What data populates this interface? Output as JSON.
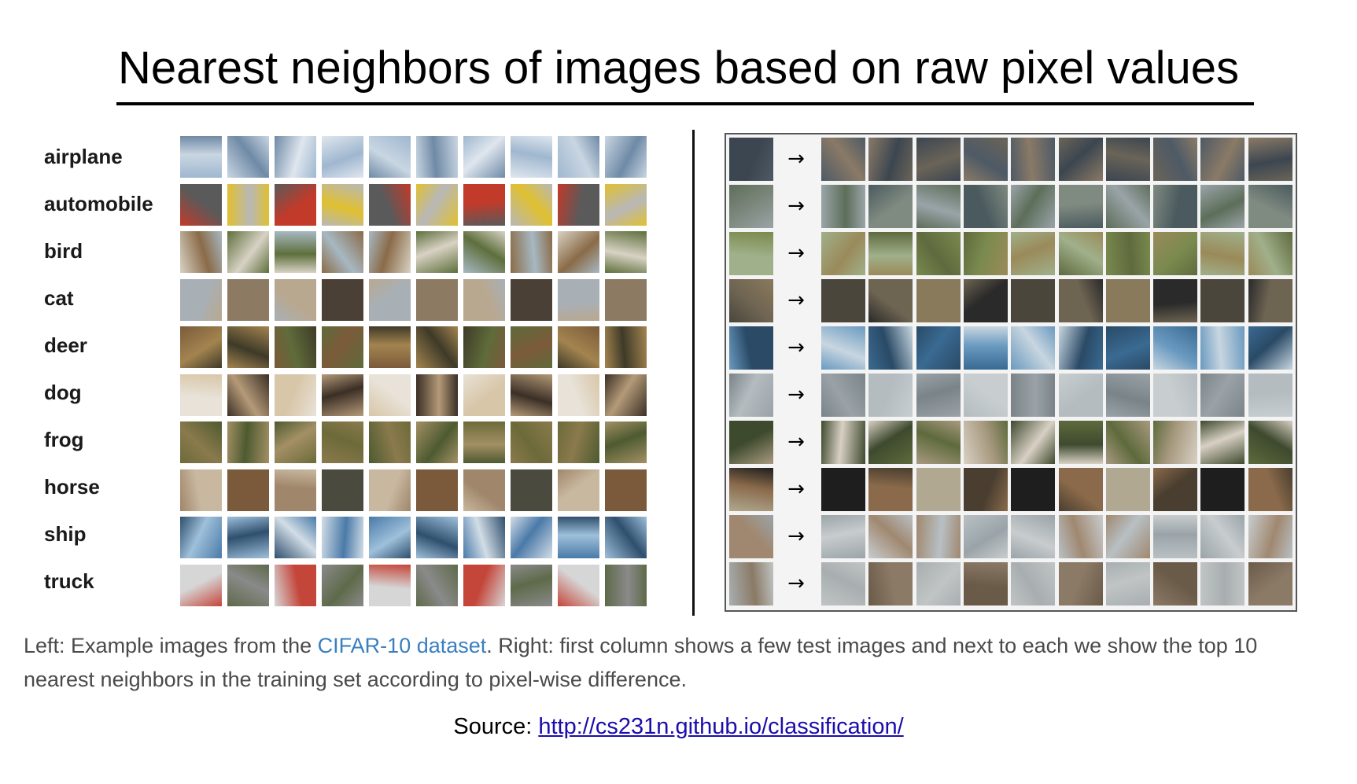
{
  "title": "Nearest neighbors of images based on raw pixel values",
  "classes": [
    "airplane",
    "automobile",
    "bird",
    "cat",
    "deer",
    "dog",
    "frog",
    "horse",
    "ship",
    "truck"
  ],
  "caption": {
    "prefix": "Left: Example images from the ",
    "link_text": "CIFAR-10 dataset",
    "suffix": ". Right: first column shows a few test images and next to each we show the top 10 nearest neighbors in the training set according to pixel-wise difference."
  },
  "source": {
    "label": "Source: ",
    "url_text": "http://cs231n.github.io/classification/"
  },
  "right_panel": {
    "arrow_glyph": "→"
  },
  "colors": {
    "caption_link": "#3a7fc0",
    "source_link": "#1a0dab"
  }
}
